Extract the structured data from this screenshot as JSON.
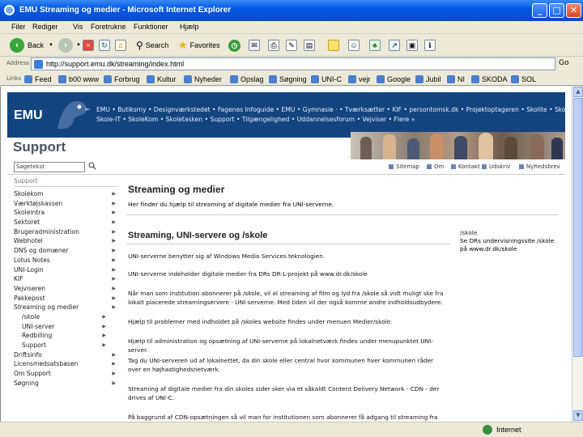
{
  "window": {
    "title": "EMU Streaming og medier - Microsoft Internet Explorer",
    "minimize": "_",
    "maximize": "□",
    "close": "✕"
  },
  "menu": [
    "Filer",
    "Rediger",
    "Vis",
    "Foretrukne",
    "Funktioner",
    "Hjælp"
  ],
  "toolbar": {
    "back_label": "Back",
    "search_label": "Search",
    "favorites_label": "Favorites"
  },
  "address": {
    "label": "Address",
    "url": "http://support.emu.dk/streaming/index.html",
    "go_label": "Go"
  },
  "links": {
    "label": "Links",
    "items": [
      "Feed",
      "b00 www",
      "Forbrug",
      "Kultur",
      "Nyheder",
      "Opslag",
      "Søgning",
      "UNI-C",
      "vejr",
      "Google",
      "Jubil",
      "NI",
      "SKODA",
      "SOL"
    ]
  },
  "page": {
    "logo": "EMU",
    "nav_line1": "EMU • Butiksmy • Designværkstedet • Fagenes Infoguide • EMU • Gymnasie · • Tværksætter • KIF • persontomsk.dk • Projektoptageren • Skolite • Skolebussen •",
    "nav_line2": "Skole-IT • SkoleKom • Skoletasken • Support • Tilgængelighed • Uddannelsesforum • Vejviser • Flere »",
    "section_title": "Support",
    "search_placeholder": "Søgetekst",
    "utilities": [
      "Sitemap",
      "Om",
      "Kontakt",
      "Udskriv",
      "Nyhedsbrev"
    ],
    "sidebar_header": "Support",
    "sidebar": [
      {
        "label": "Skolekom",
        "sub": false
      },
      {
        "label": "Værktøjskassen",
        "sub": false
      },
      {
        "label": "Skoleintra",
        "sub": false
      },
      {
        "label": "Sektoret",
        "sub": false
      },
      {
        "label": "Brugeradministration",
        "sub": false
      },
      {
        "label": "Webhotel",
        "sub": false
      },
      {
        "label": "DNS og domæner",
        "sub": false
      },
      {
        "label": "Lotus Notes",
        "sub": false
      },
      {
        "label": "UNI-Login",
        "sub": false
      },
      {
        "label": "KIF",
        "sub": false
      },
      {
        "label": "Vejviseren",
        "sub": false
      },
      {
        "label": "Pakkepost",
        "sub": false
      },
      {
        "label": "Streaming og medier",
        "sub": false
      },
      {
        "label": "/skole",
        "sub": true
      },
      {
        "label": "UNI-server",
        "sub": true
      },
      {
        "label": "Redbilling",
        "sub": true
      },
      {
        "label": "Support",
        "sub": true
      },
      {
        "label": "Driftsinfo",
        "sub": false
      },
      {
        "label": "Licensmedsatsbasen",
        "sub": false
      },
      {
        "label": "Om Support",
        "sub": false
      },
      {
        "label": "Søgning",
        "sub": false
      }
    ],
    "heading1": "Streaming og medier",
    "intro": "Her finder du hjælp til streaming af digitale medier fra UNI-serverne.",
    "heading2": "Streaming, UNI-servere og /skole",
    "paragraphs": [
      "UNI-serverne benytter sig af Windows Media Services teknologien.",
      "UNI-serverne indeholder digitale medier fra DRs DR-L-projekt på www.dr.dk/skole",
      "Når man som institution abonnerer på /skole, vil al streaming af film og lyd fra /skole så vidt muligt ske fra lokalt placerede streamingservere - UNI-serverne. Med tiden vil der også komme andre indholdsudbydere.",
      "Hjælp til problemer med indholdet på /skoles website findes under menuen Medier/skole.",
      "Hjælp til administration og opsætning af UNI-serverne på lokalnetværk findes under menupunktet UNI-server.",
      "Tag du UNI-serveren ud af lokalnettet, da din skole eller central hvor kommunen hver kommunen råder over en højhastighedsnetværk.",
      "Streaming af digitale medier fra din skoles sider sker via et såkaldt Content Delivery Network - CDN - der drives af UNI-C.",
      "På baggrund af CDN-opsætningen så vil man for institutionen som abonnerer få adgang til streaming fra sine lokale servere"
    ],
    "aside_title": "/skole",
    "aside_text": "Se DRs undervisningssite /skole på www.dr.dk/skole"
  },
  "status": {
    "zone": "Internet"
  },
  "colors": {
    "header_bg": "#13447f",
    "xp_blue": "#0058e6"
  }
}
